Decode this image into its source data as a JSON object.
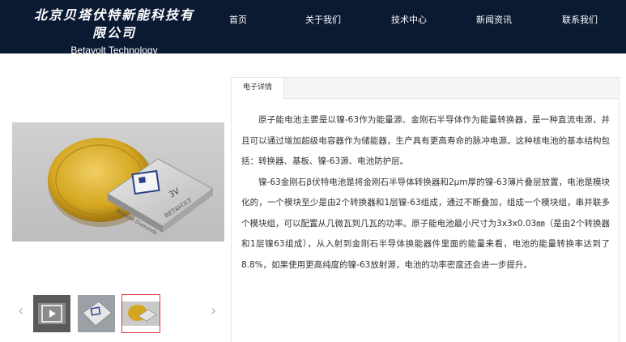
{
  "header": {
    "logo_cn": "北京贝塔伏特新能科技有限公司",
    "logo_en": "Betavolt Technology",
    "nav": [
      "首页",
      "关于我们",
      "技术中心",
      "新闻资讯",
      "联系我们"
    ]
  },
  "gallery": {
    "thumbnails": [
      "video-thumbnail",
      "chip-thumbnail",
      "coin-battery-thumbnail"
    ],
    "active_index": 2
  },
  "detail": {
    "tab_label": "电子详情",
    "paragraphs": [
      "原子能电池主要是以镍-63作为能量源、金刚石半导体作为能量转换器，是一种直流电源，并且可以通过增加超级电容器作为储能器，生产具有更高寿命的脉冲电源。这种核电池的基本结构包括：转换器、基板、镍-63源、电池防护层。",
      "镍-63金刚石β伏特电池是将金刚石半导体转换器和2μm厚的镍-63薄片叠层放置，电池是模块化的，一个模块至少是由2个转换器和1层镍-63组成，通过不断叠加，组成一个模块组，串并联多个模块组，可以配置从几微瓦到几瓦的功率。原子能电池最小尺寸为3x3x0.03㎜（是由2个转换器和1层镍63组成），从入射到金刚石半导体换能器件里面的能量来看，电池的能量转换率达到了8.8%，如果使用更高纯度的镍-63放射源，电池的功率密度还会进一步提升。"
    ]
  },
  "product_image": {
    "chip_text": [
      "3V",
      "BETAVOLT",
      "Betavolt Diamonds"
    ]
  },
  "colors": {
    "header_bg": "#0b1a33",
    "active_border": "#e03a3a",
    "coin_gold": "#d4a520"
  }
}
